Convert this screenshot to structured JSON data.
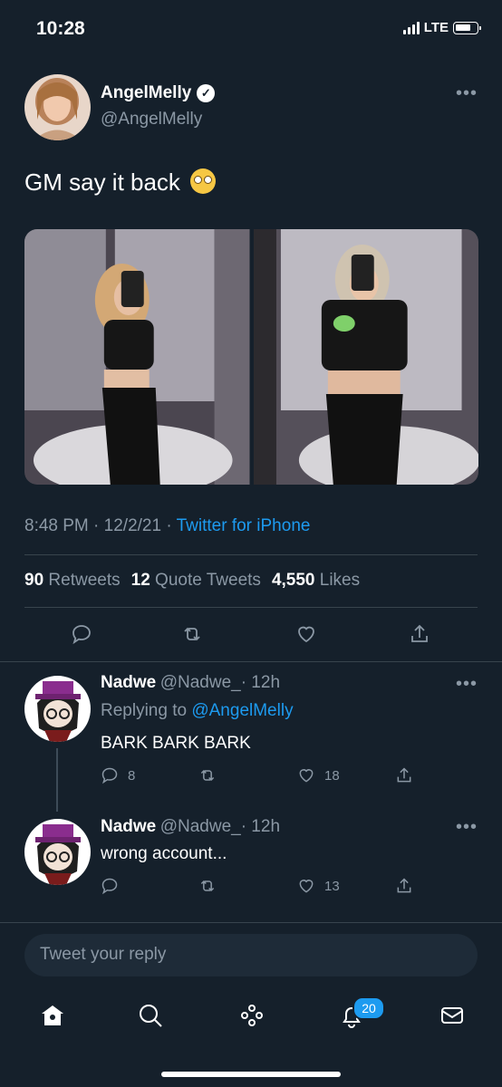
{
  "status_bar": {
    "time": "10:28",
    "network": "LTE"
  },
  "tweet": {
    "author": {
      "name": "AngelMelly",
      "handle": "@AngelMelly"
    },
    "text": "GM say it back",
    "emoji": "rolling-eyes-emoji",
    "time": "8:48 PM",
    "date": "12/2/21",
    "client": "Twitter for iPhone",
    "separator": "·",
    "stats": {
      "retweets": "90",
      "retweets_label": "Retweets",
      "quote_tweets": "12",
      "quote_tweets_label": "Quote Tweets",
      "likes": "4,550",
      "likes_label": "Likes"
    }
  },
  "replies": [
    {
      "name": "Nadwe",
      "handle": "@Nadwe_",
      "age": "· 12h",
      "replying_prefix": "Replying to",
      "replying_to": "@AngelMelly",
      "text": "BARK BARK BARK",
      "reply_count": "8",
      "like_count": "18"
    },
    {
      "name": "Nadwe",
      "handle": "@Nadwe_",
      "age": "· 12h",
      "text": "wrong account...",
      "like_count": "13"
    }
  ],
  "composer": {
    "placeholder": "Tweet your reply"
  },
  "tab_bar": {
    "notifications_badge": "20"
  },
  "colors": {
    "background": "#15202b",
    "accent": "#1d9bf0",
    "muted": "#8b98a5"
  }
}
